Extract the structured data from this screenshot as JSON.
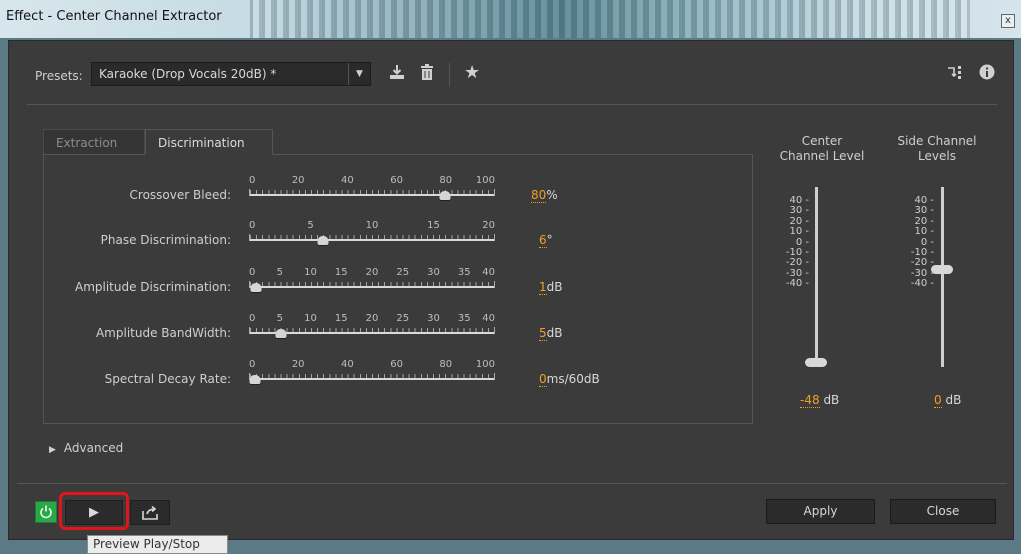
{
  "window": {
    "title": "Effect - Center Channel Extractor",
    "close_label": "x"
  },
  "presets": {
    "label": "Presets:",
    "selected": "Karaoke (Drop Vocals 20dB) *",
    "icons": [
      "save-preset-icon",
      "delete-preset-icon",
      "favorite-star-icon",
      "routing-icon",
      "info-icon"
    ]
  },
  "tabs": [
    {
      "label": "Extraction",
      "active": false
    },
    {
      "label": "Discrimination",
      "active": true
    }
  ],
  "sliders": [
    {
      "label": "Crossover Bleed:",
      "ticks": [
        "0",
        "20",
        "40",
        "60",
        "80",
        "100"
      ],
      "min": 0,
      "max": 100,
      "value": 80,
      "value_text": "80",
      "unit": "%"
    },
    {
      "label": "Phase Discrimination:",
      "ticks": [
        "0",
        "5",
        "10",
        "15",
        "20"
      ],
      "min": 0,
      "max": 20,
      "value": 6,
      "value_text": "6",
      "unit": "°"
    },
    {
      "label": "Amplitude Discrimination:",
      "ticks": [
        "0",
        "5",
        "10",
        "15",
        "20",
        "25",
        "30",
        "35",
        "40"
      ],
      "min": 0,
      "max": 40,
      "value": 1,
      "value_text": "1",
      "unit": "dB"
    },
    {
      "label": "Amplitude BandWidth:",
      "ticks": [
        "0",
        "5",
        "10",
        "15",
        "20",
        "25",
        "30",
        "35",
        "40"
      ],
      "min": 0,
      "max": 40,
      "value": 5,
      "value_text": "5",
      "unit": "dB"
    },
    {
      "label": "Spectral Decay Rate:",
      "ticks": [
        "0",
        "20",
        "40",
        "60",
        "80",
        "100"
      ],
      "min": 0,
      "max": 100,
      "value": 0,
      "value_text": "0",
      "unit": "ms/60dB"
    }
  ],
  "meters": [
    {
      "title_line1": "Center",
      "title_line2": "Channel Level",
      "value": -48,
      "value_text": "-48",
      "unit": "dB"
    },
    {
      "title_line1": "Side Channel",
      "title_line2": "Levels",
      "value": 0,
      "value_text": "0",
      "unit": "dB"
    }
  ],
  "meter_scale": [
    "40",
    "30",
    "20",
    "10",
    "0",
    "-10",
    "-20",
    "-30",
    "-40"
  ],
  "advanced": {
    "label": "Advanced"
  },
  "buttons": {
    "apply": "Apply",
    "close": "Close"
  },
  "tooltip": "Preview Play/Stop"
}
